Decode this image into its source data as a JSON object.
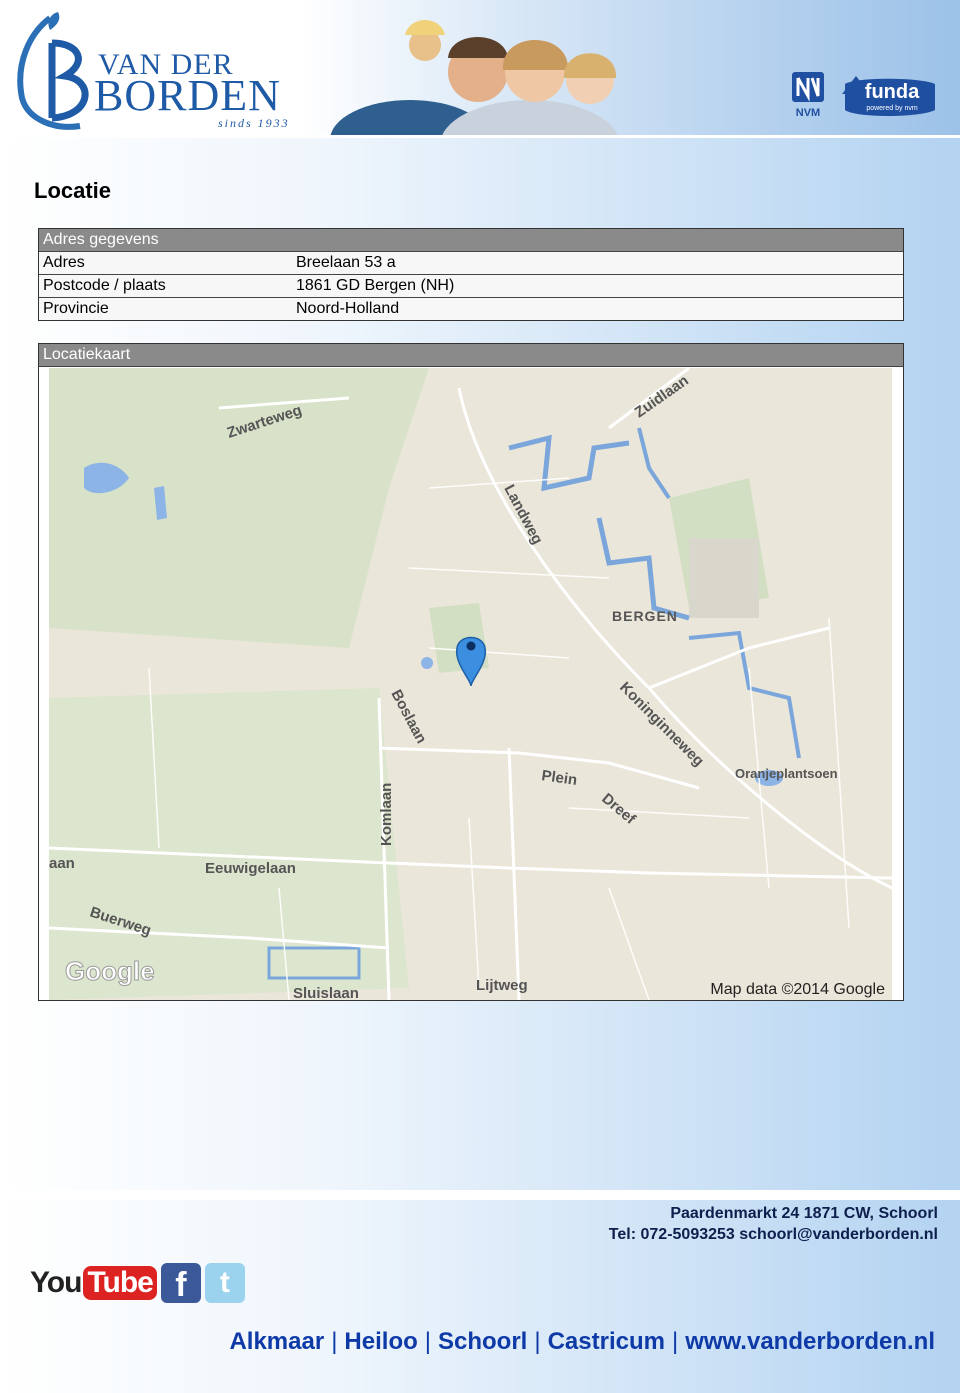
{
  "header": {
    "logo": {
      "line1": "VAN DER",
      "line2": "BORDEN",
      "since": "sinds 1933"
    },
    "badges": [
      {
        "icon": "nvm-logo",
        "text": "NVM"
      },
      {
        "icon": "funda-logo",
        "text": "funda",
        "subtext": "powered by nvm"
      }
    ]
  },
  "title": "Locatie",
  "address_section": {
    "header": "Adres gegevens",
    "rows": [
      {
        "label": "Adres",
        "value": "Breelaan 53 a"
      },
      {
        "label": "Postcode / plaats",
        "value": "1861 GD  Bergen (NH)"
      },
      {
        "label": "Provincie",
        "value": "Noord-Holland"
      }
    ]
  },
  "map_section": {
    "header": "Locatiekaart",
    "streets": {
      "zwarteweg": "Zwarteweg",
      "zuidlaan": "Zuidlaan",
      "landweg": "Landweg",
      "bergen": "BERGEN",
      "koninginneweg": "Koninginneweg",
      "boslaan": "Boslaan",
      "plein": "Plein",
      "dreef": "Dreef",
      "oranjeplantsoen": "Oranjeplantsoen",
      "komlaan": "Komlaan",
      "eeuwigelaan": "Eeuwigelaan",
      "aan": "aan",
      "buerweg": "Buerweg",
      "sluislaan": "Sluislaan",
      "lijtweg": "Lijtweg"
    },
    "google": "Google",
    "attribution": "Map data ©2014 Google",
    "marker_icon": "location-pin-icon"
  },
  "footer": {
    "address": "Paardenmarkt 24 1871 CW, Schoorl",
    "contact": "Tel: 072-5093253 schoorl@vanderborden.nl",
    "social": [
      {
        "icon": "youtube-icon",
        "text_you": "You",
        "text_tube": "Tube"
      },
      {
        "icon": "facebook-icon",
        "text": "f"
      },
      {
        "icon": "twitter-icon",
        "text": "t"
      }
    ],
    "offices": [
      "Alkmaar",
      "Heiloo",
      "Schoorl",
      "Castricum",
      "www.vanderborden.nl"
    ]
  }
}
